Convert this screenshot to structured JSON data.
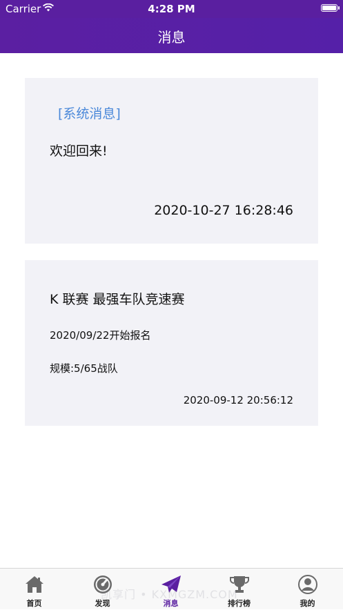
{
  "status_bar": {
    "carrier": "Carrier",
    "time": "4:28 PM"
  },
  "nav": {
    "title": "消息"
  },
  "messages": [
    {
      "tag": "[系统消息]",
      "text": "欢迎回来!",
      "timestamp": "2020-10-27 16:28:46"
    },
    {
      "headline": "K 联赛 最强车队竞速赛",
      "signup": "2020/09/22开始报名",
      "scale": "规模:5/65战队",
      "timestamp": "2020-09-12 20:56:12"
    }
  ],
  "tabs": [
    {
      "label": "首页",
      "icon": "home-icon"
    },
    {
      "label": "发现",
      "icon": "discover-icon"
    },
    {
      "label": "消息",
      "icon": "message-icon",
      "active": true
    },
    {
      "label": "排行榜",
      "icon": "trophy-icon"
    },
    {
      "label": "我的",
      "icon": "profile-icon"
    }
  ],
  "watermark": "凯享门 • KXMGZM.COM",
  "colors": {
    "accent": "#5a1fa0",
    "tag_blue": "#4a88d9",
    "card_bg": "#f2f2f7"
  }
}
